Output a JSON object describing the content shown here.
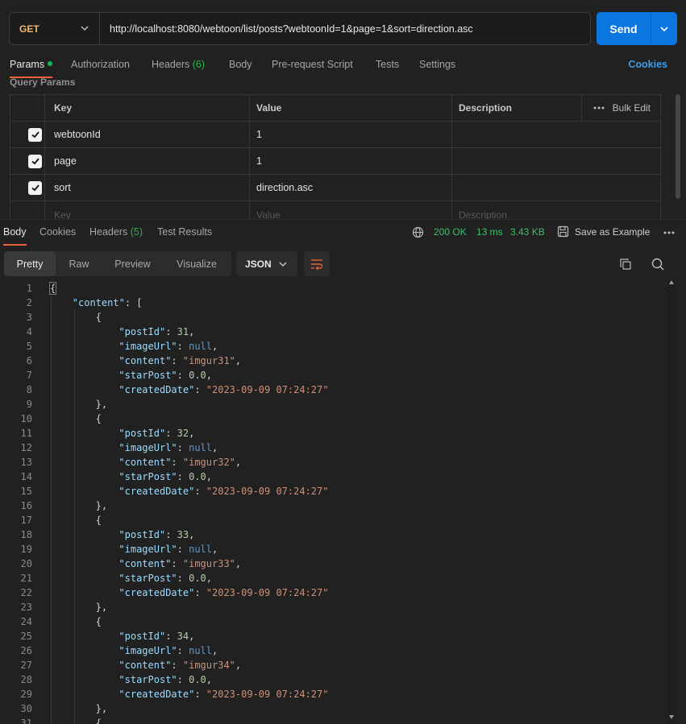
{
  "request": {
    "method": "GET",
    "url": "http://localhost:8080/webtoon/list/posts?webtoonId=1&page=1&sort=direction.asc",
    "send_label": "Send"
  },
  "request_tabs": [
    {
      "label": "Params",
      "active": true,
      "indicator": true
    },
    {
      "label": "Authorization"
    },
    {
      "label": "Headers",
      "count": "(6)"
    },
    {
      "label": "Body"
    },
    {
      "label": "Pre-request Script"
    },
    {
      "label": "Tests"
    },
    {
      "label": "Settings"
    }
  ],
  "cookies_link": "Cookies",
  "query_params": {
    "title": "Query Params",
    "headers": {
      "key": "Key",
      "value": "Value",
      "description": "Description",
      "bulk_edit": "Bulk Edit"
    },
    "rows": [
      {
        "checked": true,
        "key": "webtoonId",
        "value": "1",
        "description": ""
      },
      {
        "checked": true,
        "key": "page",
        "value": "1",
        "description": ""
      },
      {
        "checked": true,
        "key": "sort",
        "value": "direction.asc",
        "description": ""
      }
    ],
    "placeholder": {
      "key": "Key",
      "value": "Value",
      "description": "Description"
    }
  },
  "response_tabs": [
    {
      "label": "Body",
      "active": true
    },
    {
      "label": "Cookies"
    },
    {
      "label": "Headers",
      "count": "(5)"
    },
    {
      "label": "Test Results"
    }
  ],
  "response_meta": {
    "status": "200 OK",
    "time": "13 ms",
    "size": "3.43 KB",
    "save_example": "Save as Example"
  },
  "format_tabs": [
    {
      "label": "Pretty",
      "active": true
    },
    {
      "label": "Raw"
    },
    {
      "label": "Preview"
    },
    {
      "label": "Visualize"
    }
  ],
  "format_select": "JSON",
  "code_lines": [
    {
      "n": "1",
      "indent": 0,
      "parts": [
        [
          "p",
          "{"
        ]
      ]
    },
    {
      "n": "2",
      "indent": 1,
      "parts": [
        [
          "k",
          "\"content\""
        ],
        [
          "p",
          ": ["
        ]
      ]
    },
    {
      "n": "3",
      "indent": 2,
      "parts": [
        [
          "p",
          "{"
        ]
      ]
    },
    {
      "n": "4",
      "indent": 3,
      "parts": [
        [
          "k",
          "\"postId\""
        ],
        [
          "p",
          ": "
        ],
        [
          "n",
          "31"
        ],
        [
          "p",
          ","
        ]
      ]
    },
    {
      "n": "5",
      "indent": 3,
      "parts": [
        [
          "k",
          "\"imageUrl\""
        ],
        [
          "p",
          ": "
        ],
        [
          "nl",
          "null"
        ],
        [
          "p",
          ","
        ]
      ]
    },
    {
      "n": "6",
      "indent": 3,
      "parts": [
        [
          "k",
          "\"content\""
        ],
        [
          "p",
          ": "
        ],
        [
          "s",
          "\"imgur31\""
        ],
        [
          "p",
          ","
        ]
      ]
    },
    {
      "n": "7",
      "indent": 3,
      "parts": [
        [
          "k",
          "\"starPost\""
        ],
        [
          "p",
          ": "
        ],
        [
          "n",
          "0.0"
        ],
        [
          "p",
          ","
        ]
      ]
    },
    {
      "n": "8",
      "indent": 3,
      "parts": [
        [
          "k",
          "\"createdDate\""
        ],
        [
          "p",
          ": "
        ],
        [
          "s",
          "\"2023-09-09 07:24:27\""
        ]
      ]
    },
    {
      "n": "9",
      "indent": 2,
      "parts": [
        [
          "p",
          "},"
        ]
      ]
    },
    {
      "n": "10",
      "indent": 2,
      "parts": [
        [
          "p",
          "{"
        ]
      ]
    },
    {
      "n": "11",
      "indent": 3,
      "parts": [
        [
          "k",
          "\"postId\""
        ],
        [
          "p",
          ": "
        ],
        [
          "n",
          "32"
        ],
        [
          "p",
          ","
        ]
      ]
    },
    {
      "n": "12",
      "indent": 3,
      "parts": [
        [
          "k",
          "\"imageUrl\""
        ],
        [
          "p",
          ": "
        ],
        [
          "nl",
          "null"
        ],
        [
          "p",
          ","
        ]
      ]
    },
    {
      "n": "13",
      "indent": 3,
      "parts": [
        [
          "k",
          "\"content\""
        ],
        [
          "p",
          ": "
        ],
        [
          "s",
          "\"imgur32\""
        ],
        [
          "p",
          ","
        ]
      ]
    },
    {
      "n": "14",
      "indent": 3,
      "parts": [
        [
          "k",
          "\"starPost\""
        ],
        [
          "p",
          ": "
        ],
        [
          "n",
          "0.0"
        ],
        [
          "p",
          ","
        ]
      ]
    },
    {
      "n": "15",
      "indent": 3,
      "parts": [
        [
          "k",
          "\"createdDate\""
        ],
        [
          "p",
          ": "
        ],
        [
          "s",
          "\"2023-09-09 07:24:27\""
        ]
      ]
    },
    {
      "n": "16",
      "indent": 2,
      "parts": [
        [
          "p",
          "},"
        ]
      ]
    },
    {
      "n": "17",
      "indent": 2,
      "parts": [
        [
          "p",
          "{"
        ]
      ]
    },
    {
      "n": "18",
      "indent": 3,
      "parts": [
        [
          "k",
          "\"postId\""
        ],
        [
          "p",
          ": "
        ],
        [
          "n",
          "33"
        ],
        [
          "p",
          ","
        ]
      ]
    },
    {
      "n": "19",
      "indent": 3,
      "parts": [
        [
          "k",
          "\"imageUrl\""
        ],
        [
          "p",
          ": "
        ],
        [
          "nl",
          "null"
        ],
        [
          "p",
          ","
        ]
      ]
    },
    {
      "n": "20",
      "indent": 3,
      "parts": [
        [
          "k",
          "\"content\""
        ],
        [
          "p",
          ": "
        ],
        [
          "s",
          "\"imgur33\""
        ],
        [
          "p",
          ","
        ]
      ]
    },
    {
      "n": "21",
      "indent": 3,
      "parts": [
        [
          "k",
          "\"starPost\""
        ],
        [
          "p",
          ": "
        ],
        [
          "n",
          "0.0"
        ],
        [
          "p",
          ","
        ]
      ]
    },
    {
      "n": "22",
      "indent": 3,
      "parts": [
        [
          "k",
          "\"createdDate\""
        ],
        [
          "p",
          ": "
        ],
        [
          "s",
          "\"2023-09-09 07:24:27\""
        ]
      ]
    },
    {
      "n": "23",
      "indent": 2,
      "parts": [
        [
          "p",
          "},"
        ]
      ]
    },
    {
      "n": "24",
      "indent": 2,
      "parts": [
        [
          "p",
          "{"
        ]
      ]
    },
    {
      "n": "25",
      "indent": 3,
      "parts": [
        [
          "k",
          "\"postId\""
        ],
        [
          "p",
          ": "
        ],
        [
          "n",
          "34"
        ],
        [
          "p",
          ","
        ]
      ]
    },
    {
      "n": "26",
      "indent": 3,
      "parts": [
        [
          "k",
          "\"imageUrl\""
        ],
        [
          "p",
          ": "
        ],
        [
          "nl",
          "null"
        ],
        [
          "p",
          ","
        ]
      ]
    },
    {
      "n": "27",
      "indent": 3,
      "parts": [
        [
          "k",
          "\"content\""
        ],
        [
          "p",
          ": "
        ],
        [
          "s",
          "\"imgur34\""
        ],
        [
          "p",
          ","
        ]
      ]
    },
    {
      "n": "28",
      "indent": 3,
      "parts": [
        [
          "k",
          "\"starPost\""
        ],
        [
          "p",
          ": "
        ],
        [
          "n",
          "0.0"
        ],
        [
          "p",
          ","
        ]
      ]
    },
    {
      "n": "29",
      "indent": 3,
      "parts": [
        [
          "k",
          "\"createdDate\""
        ],
        [
          "p",
          ": "
        ],
        [
          "s",
          "\"2023-09-09 07:24:27\""
        ]
      ]
    },
    {
      "n": "30",
      "indent": 2,
      "parts": [
        [
          "p",
          "},"
        ]
      ]
    },
    {
      "n": "31",
      "indent": 2,
      "parts": [
        [
          "p",
          "{"
        ]
      ]
    }
  ],
  "icons": {
    "method_dropdown": "chevron-down-icon",
    "send_dropdown": "chevron-down-icon",
    "more": "ellipsis-icon",
    "globe": "globe-icon",
    "save": "save-icon",
    "wrap": "wrap-lines-icon",
    "copy": "copy-icon",
    "search": "search-icon"
  },
  "colors": {
    "accent_send": "#0b76e0",
    "method": "#f2b86b",
    "active_tab_underline": "#e5643b",
    "status_ok": "#3fbf6a",
    "cookies_link": "#3d9ae8"
  }
}
